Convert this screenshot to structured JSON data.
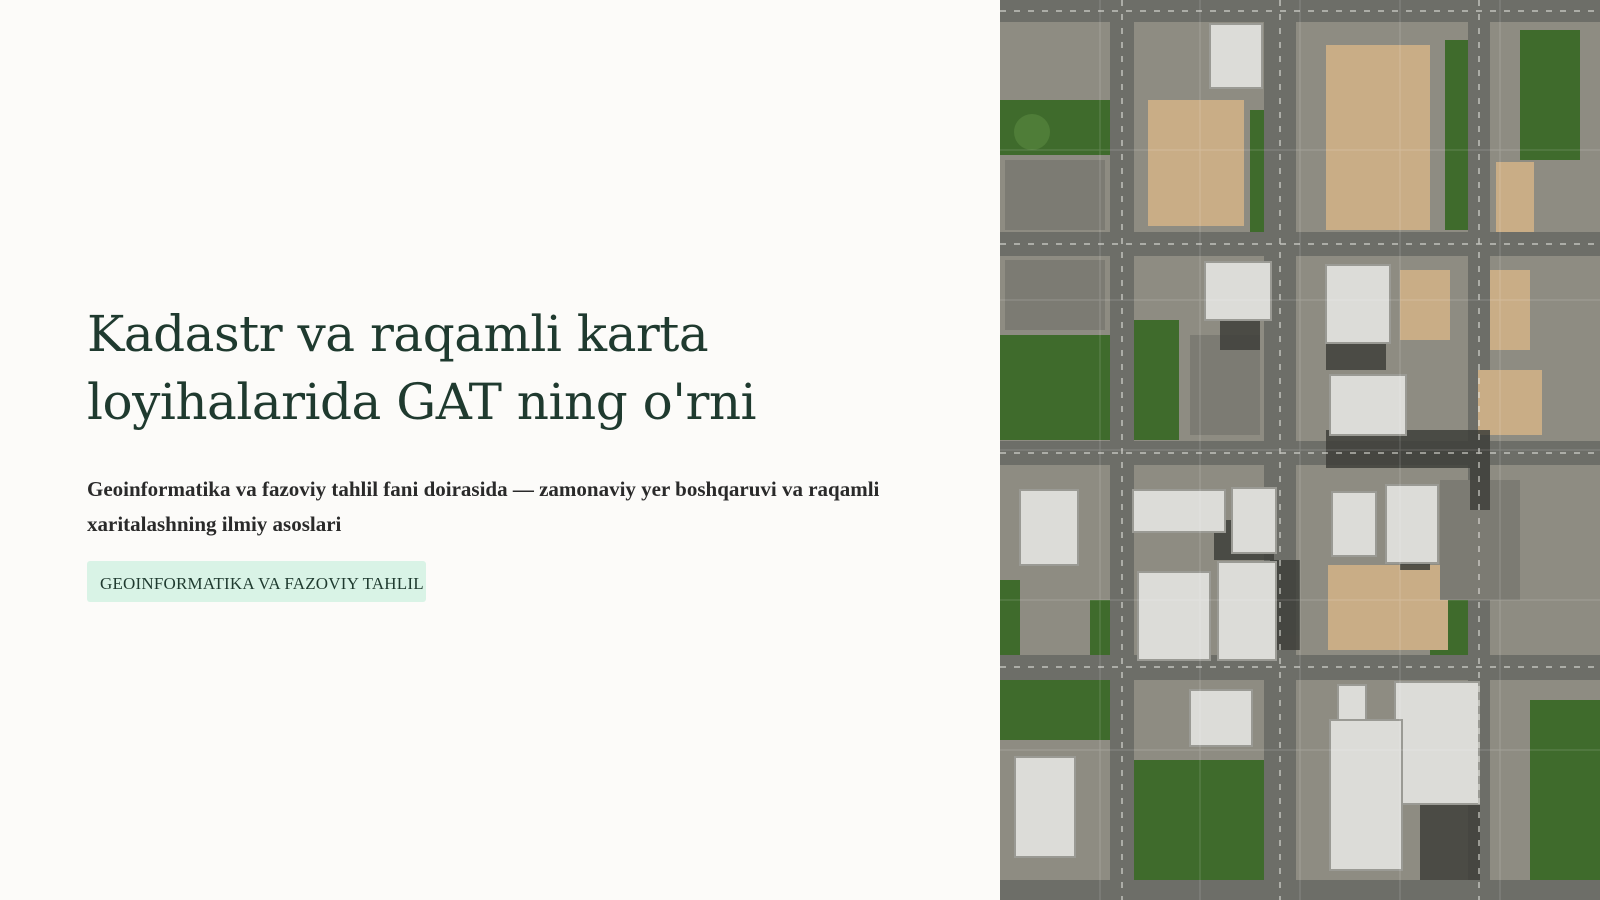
{
  "slide": {
    "title": "Kadastr va raqamli karta loyihalarida GAT ning o'rni",
    "subtitle": "Geoinformatika va fazoviy tahlil fani doirasida — zamonaviy yer boshqaruvi va raqamli xaritalashning ilmiy asoslari",
    "tag": "GEOINFORMATIKA VA FAZOVIY TAHLIL"
  },
  "colors": {
    "background": "#fcfbf9",
    "title": "#1f3a2f",
    "subtitle": "#2a2a2a",
    "tag_background": "#d9f3e6",
    "tag_text": "#1f3a2f",
    "road": "#6d6e68",
    "vegetation": "#3f6b2c",
    "construction": "#c9ad86",
    "roof": "#dcdcd8"
  }
}
